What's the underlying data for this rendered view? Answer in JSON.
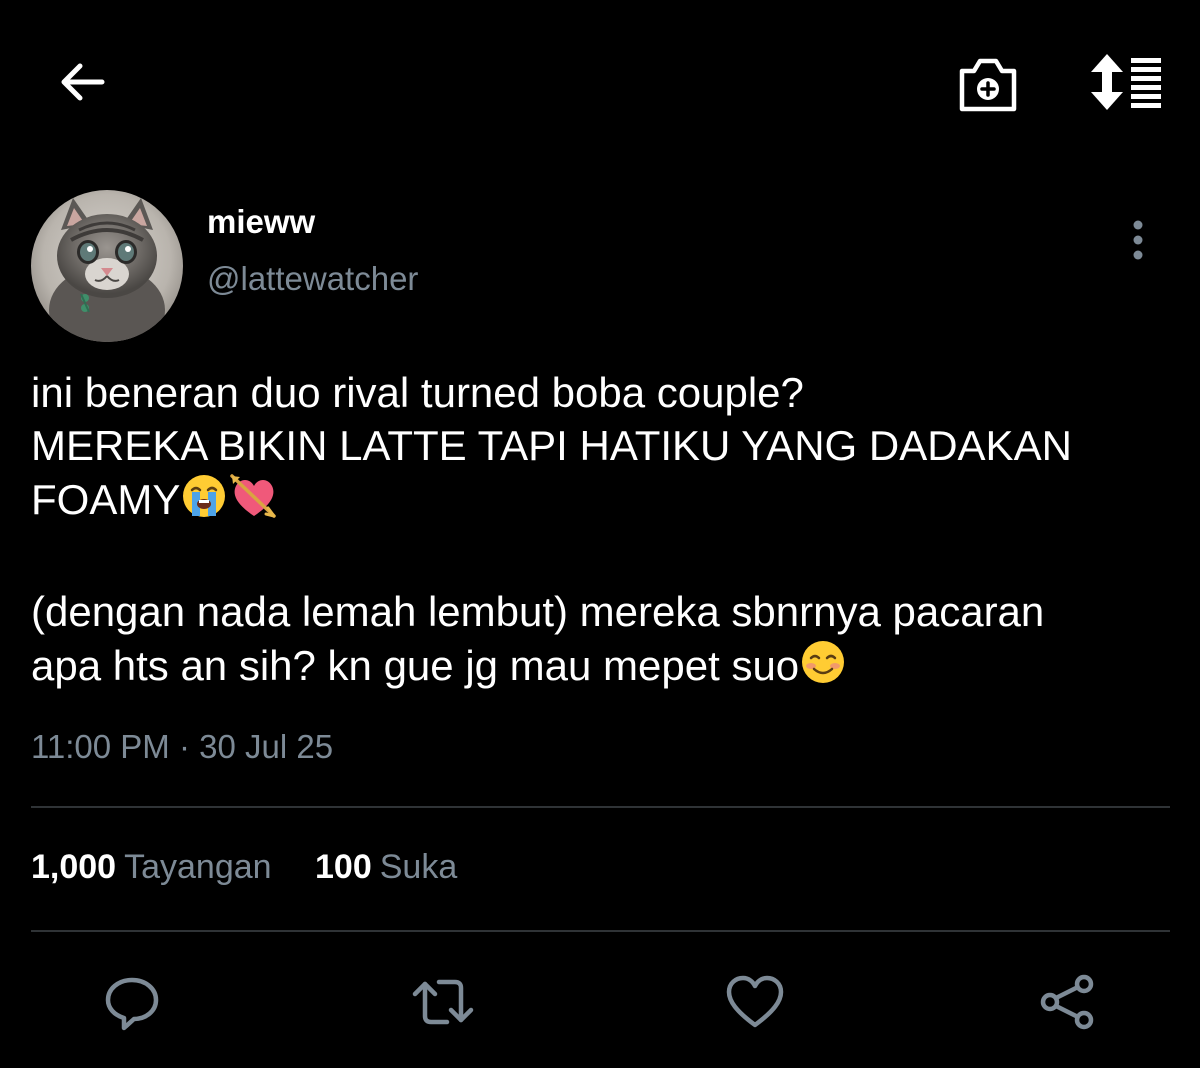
{
  "header": {
    "back_icon": "arrow-left-icon",
    "camera_icon": "camera-plus-icon",
    "sort_icon": "sort-list-icon"
  },
  "tweet": {
    "author": {
      "name": "mieww",
      "handle": "@lattewatcher",
      "avatar": "kitten-avatar"
    },
    "more_icon": "more-vertical-icon",
    "text": {
      "line1": "ini beneran duo rival turned boba couple?",
      "line2": "MEREKA BIKIN LATTE TAPI HATIKU YANG DADAKAN",
      "line3": "FOAMY",
      "line4": "(dengan nada lemah lembut) mereka sbnrnya pacaran",
      "line5": "apa hts an sih? kn gue jg mau mepet suo"
    },
    "emojis": [
      "crying-face-emoji",
      "heart-with-arrow-emoji",
      "smiling-face-emoji"
    ],
    "timestamp": "11:00 PM · 30 Jul 25"
  },
  "stats": {
    "views_count": "1,000",
    "views_label": "Tayangan",
    "likes_count": "100",
    "likes_label": "Suka"
  },
  "actions": {
    "reply_icon": "reply-icon",
    "retweet_icon": "retweet-icon",
    "like_icon": "heart-icon",
    "share_icon": "share-icon"
  },
  "colors": {
    "background": "#000000",
    "text_primary": "#ffffff",
    "text_secondary": "#7d8a96",
    "divider": "#2f3336",
    "icon": "#7d8a96"
  }
}
